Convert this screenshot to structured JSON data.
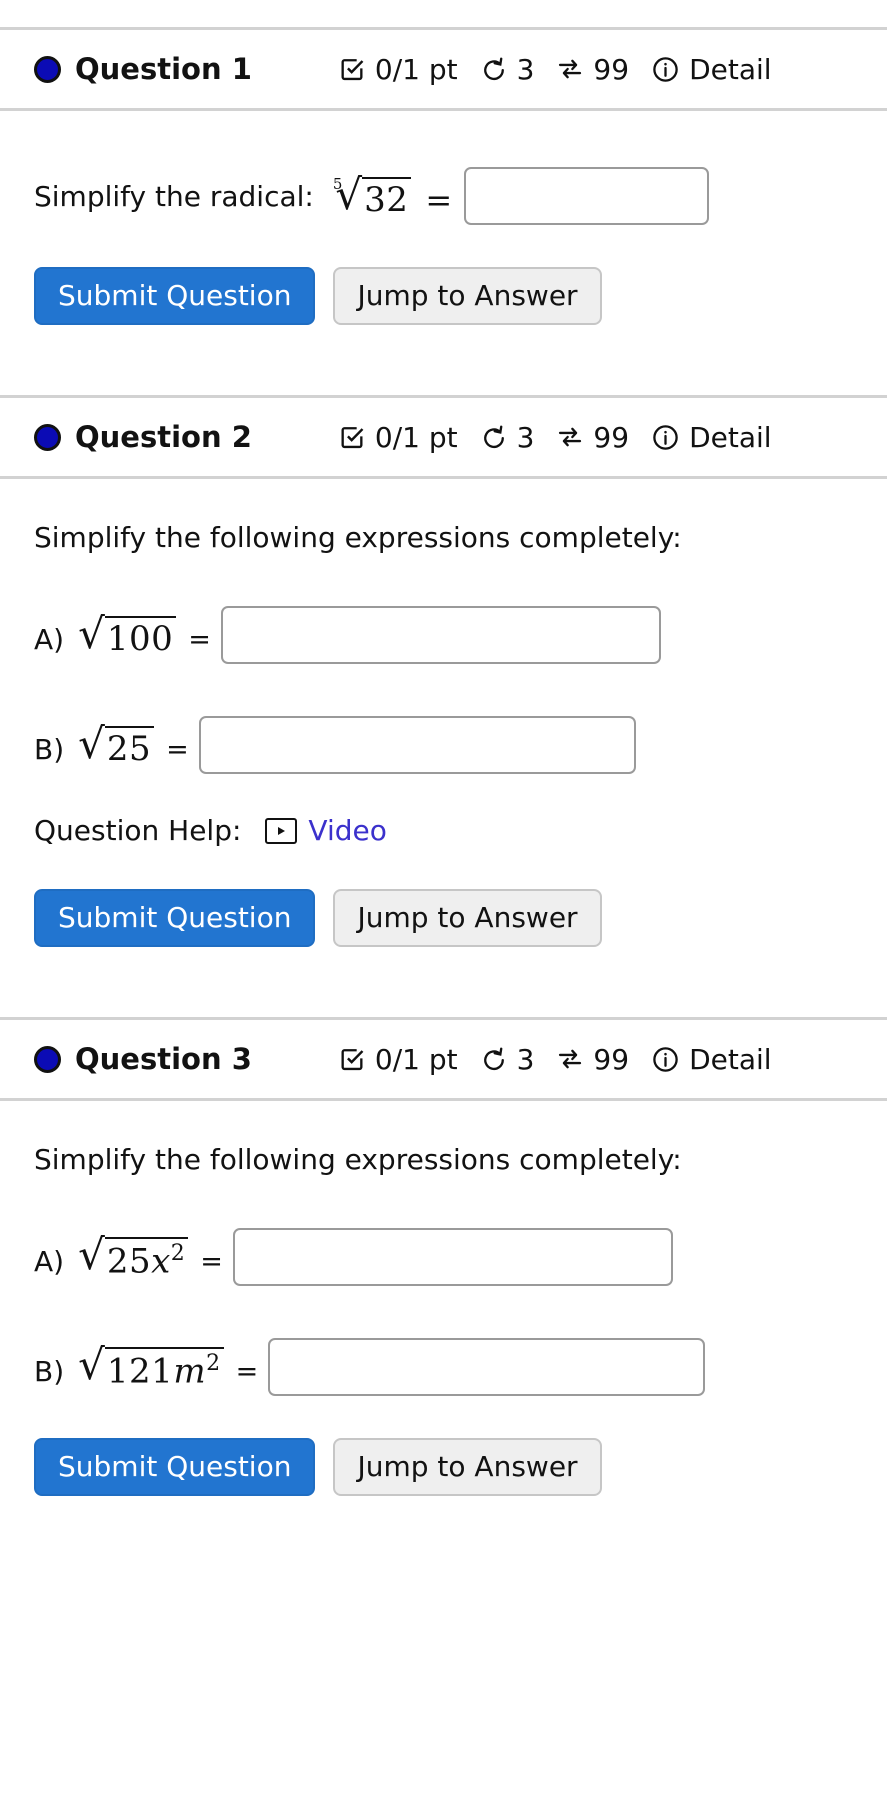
{
  "meta": {
    "accent_blue": "#2275d0",
    "dot_blue": "#0b0bb5",
    "link_purple": "#3b31cc",
    "separator_gray": "#d2d2d2"
  },
  "labels": {
    "details": "Detail",
    "points": "0/1 pt",
    "attempts": "3",
    "versions": "99",
    "submit": "Submit Question",
    "jump": "Jump to Answer",
    "question_help": "Question Help:",
    "video": "Video",
    "equals": "=",
    "equals_math": "=",
    "part_a": "A)",
    "part_b": "B)",
    "icons": {
      "score": "checkbox-checked-icon",
      "attempts": "undo-arrow-icon",
      "versions": "shuffle-arrows-icon",
      "details": "info-circle-icon",
      "video": "video-play-icon",
      "status": "question-status-dot"
    }
  },
  "questions": [
    {
      "title": "Question 1",
      "points": "0/1 pt",
      "attempts": "3",
      "versions": "99",
      "details": "Detail",
      "prompt": "Simplify the radical:",
      "statement": "",
      "radical": {
        "index": "5",
        "radicand": "32"
      },
      "input_value": "",
      "input_placeholder": "",
      "has_help": false,
      "parts": []
    },
    {
      "title": "Question 2",
      "points": "0/1 pt",
      "attempts": "3",
      "versions": "99",
      "details": "Detail",
      "prompt": "",
      "statement": "Simplify the following expressions completely:",
      "has_help": true,
      "help_label": "Question Help:",
      "help_link": "Video",
      "parts": [
        {
          "letter": "A)",
          "radicand": "100",
          "index": "",
          "input_value": "",
          "input_width": 440
        },
        {
          "letter": "B)",
          "radicand": "25",
          "index": "",
          "input_value": "",
          "input_width": 437
        }
      ]
    },
    {
      "title": "Question 3",
      "points": "0/1 pt",
      "attempts": "3",
      "versions": "99",
      "details": "Detail",
      "prompt": "",
      "statement": "Simplify the following expressions completely:",
      "has_help": false,
      "parts": [
        {
          "letter": "A)",
          "radicand": "25x",
          "exponent": "2",
          "index": "",
          "input_value": "",
          "input_width": 440
        },
        {
          "letter": "B)",
          "radicand": "121m",
          "exponent": "2",
          "index": "",
          "input_value": "",
          "input_width": 437
        }
      ]
    }
  ]
}
